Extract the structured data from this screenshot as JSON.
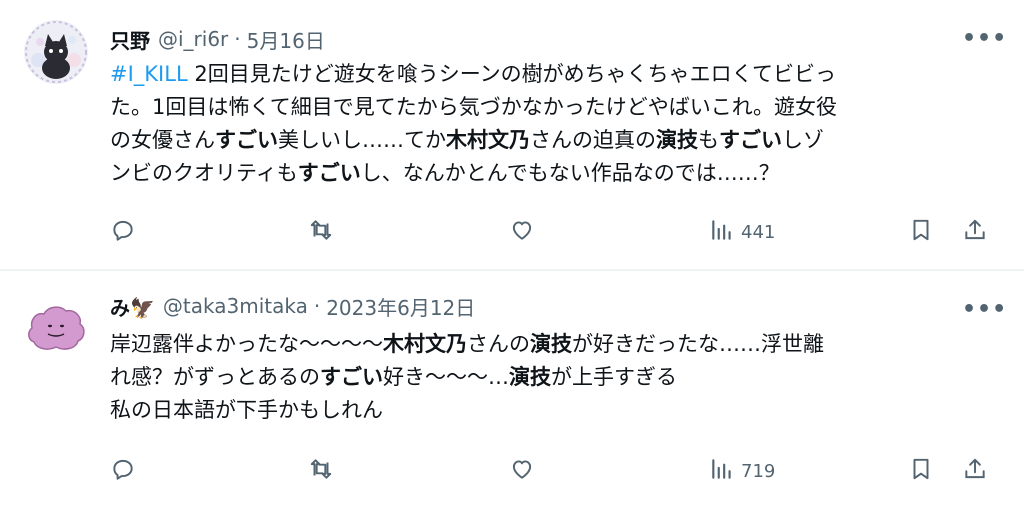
{
  "tweets": [
    {
      "name": "只野",
      "handle": "@i_ri6r",
      "separator": "·",
      "date": "5月16日",
      "more": "•••",
      "lines": [
        [
          {
            "t": "#I_KILL",
            "k": "hashtag"
          },
          {
            "t": "  2回目見たけど遊女を喰うシーンの樹がめちゃくちゃエロくてビビっ",
            "k": "text"
          }
        ],
        [
          {
            "t": "た。1回目は怖くて細目で見てたから気づかなかったけどやばいこれ。遊女役",
            "k": "text"
          }
        ],
        [
          {
            "t": "の女優さん",
            "k": "text"
          },
          {
            "t": "すごい",
            "k": "bold"
          },
          {
            "t": "美しいし……てか",
            "k": "text"
          },
          {
            "t": "木村文乃",
            "k": "bold"
          },
          {
            "t": "さんの迫真の",
            "k": "text"
          },
          {
            "t": "演技",
            "k": "bold"
          },
          {
            "t": "も",
            "k": "text"
          },
          {
            "t": "すごい",
            "k": "bold"
          },
          {
            "t": "しゾ",
            "k": "text"
          }
        ],
        [
          {
            "t": "ンビのクオリティも",
            "k": "text"
          },
          {
            "t": "すごい",
            "k": "bold"
          },
          {
            "t": "し、なんかとんでもない作品なのでは……？",
            "k": "text"
          }
        ]
      ],
      "views": "441"
    },
    {
      "name": "み🦅",
      "handle": "@taka3mitaka",
      "separator": "·",
      "date": "2023年6月12日",
      "more": "•••",
      "lines": [
        [
          {
            "t": "岸辺露伴よかったな〜〜〜〜",
            "k": "text"
          },
          {
            "t": "木村文乃",
            "k": "bold"
          },
          {
            "t": "さんの",
            "k": "text"
          },
          {
            "t": "演技",
            "k": "bold"
          },
          {
            "t": "が好きだったな……浮世離",
            "k": "text"
          }
        ],
        [
          {
            "t": "れ感？がずっとあるの",
            "k": "text"
          },
          {
            "t": "すごい",
            "k": "bold"
          },
          {
            "t": "好き〜〜〜…",
            "k": "text"
          },
          {
            "t": "演技",
            "k": "bold"
          },
          {
            "t": "が上手すぎる",
            "k": "text"
          }
        ],
        [
          {
            "t": "私の日本語が下手かもしれん",
            "k": "text"
          }
        ]
      ],
      "views": "719"
    }
  ],
  "icons": {
    "reply": "reply-icon",
    "retweet": "retweet-icon",
    "like": "like-heart-icon",
    "views": "views-bar-chart-icon",
    "bookmark": "bookmark-icon",
    "share": "share-upload-icon"
  },
  "colors": {
    "text": "#0f1419",
    "secondary": "#536471",
    "hashtag": "#1d9bf0",
    "divider": "#eff3f4"
  }
}
